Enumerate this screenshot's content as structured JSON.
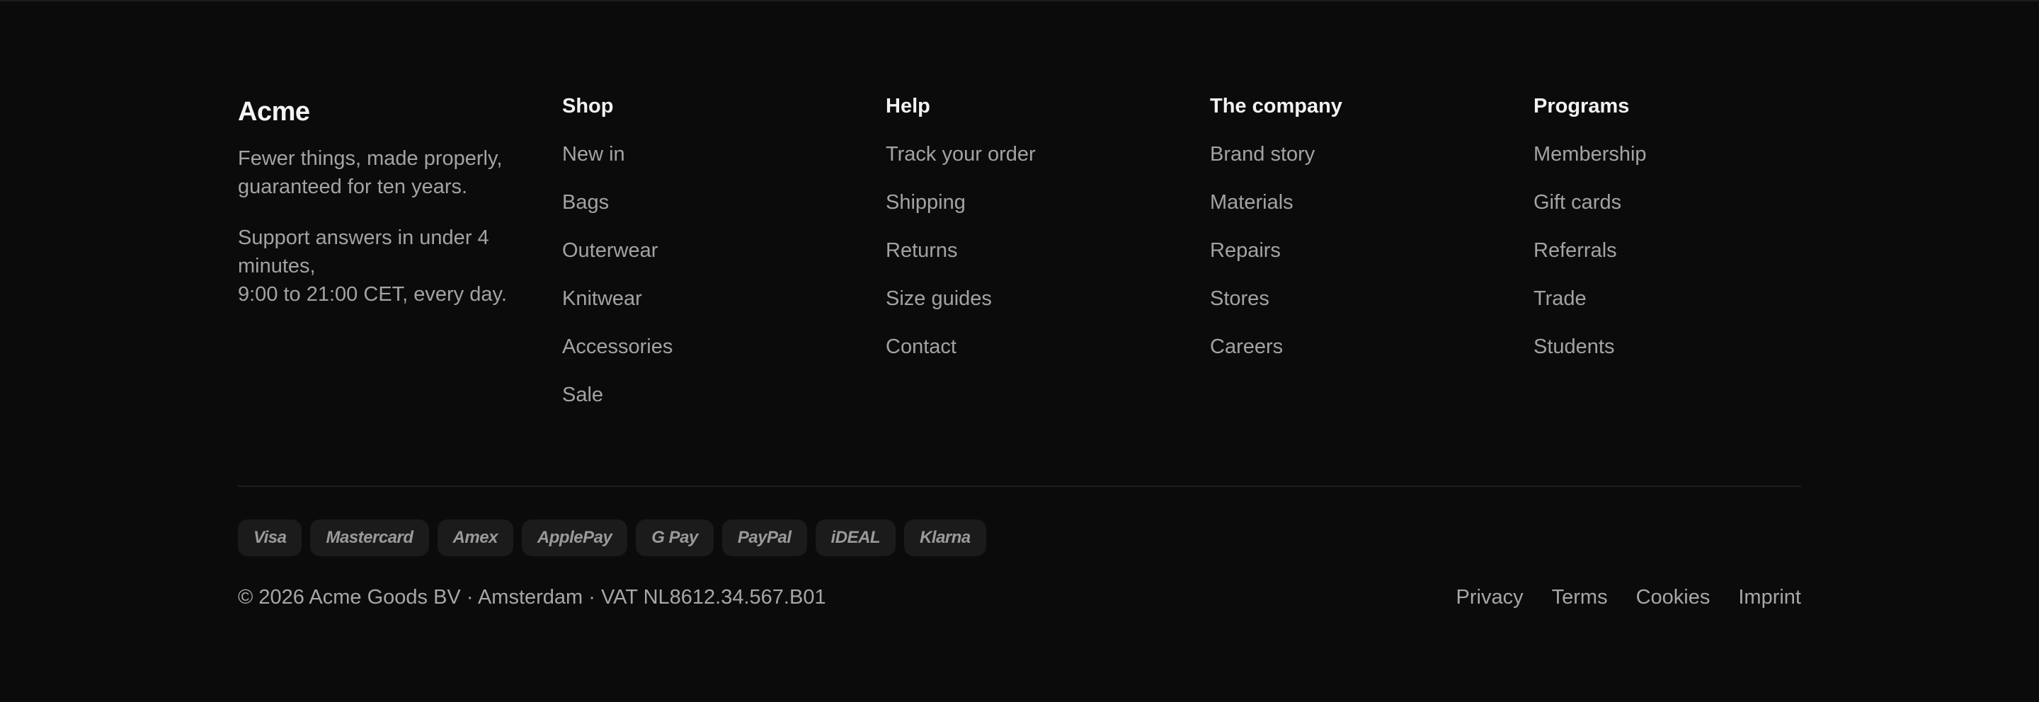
{
  "brand": {
    "name": "Acme",
    "tagline": "Fewer things, made properly, guaranteed for ten years.",
    "support_line1": "Support answers in under 4 minutes,",
    "support_line2": "9:00 to 21:00 CET, every day."
  },
  "columns": [
    {
      "title": "Shop",
      "items": [
        "New in",
        "Bags",
        "Outerwear",
        "Knitwear",
        "Accessories",
        "Sale"
      ]
    },
    {
      "title": "Help",
      "items": [
        "Track your order",
        "Shipping",
        "Returns",
        "Size guides",
        "Contact"
      ]
    },
    {
      "title": "The company",
      "items": [
        "Brand story",
        "Materials",
        "Repairs",
        "Stores",
        "Careers"
      ]
    },
    {
      "title": "Programs",
      "items": [
        "Membership",
        "Gift cards",
        "Referrals",
        "Trade",
        "Students"
      ]
    }
  ],
  "payments": [
    "Visa",
    "Mastercard",
    "Amex",
    "ApplePay",
    "G Pay",
    "PayPal",
    "iDEAL",
    "Klarna"
  ],
  "copyright": "© 2026 Acme Goods BV · Amsterdam · VAT NL8612.34.567.B01",
  "legal": [
    "Privacy",
    "Terms",
    "Cookies",
    "Imprint"
  ]
}
